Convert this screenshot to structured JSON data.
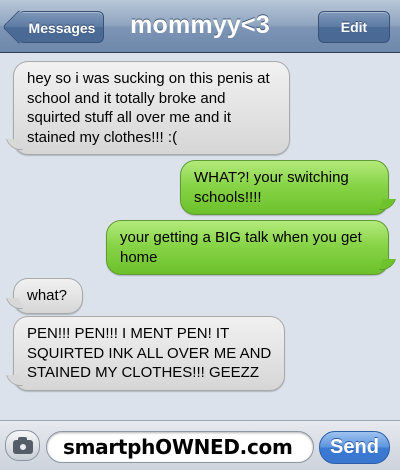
{
  "navbar": {
    "back_label": "Messages",
    "title": "mommyy<3",
    "edit_label": "Edit"
  },
  "messages": [
    {
      "direction": "incoming",
      "text": "hey so i was sucking on this penis at school and it totally broke and squirted stuff all over me and it stained my clothes!!! :("
    },
    {
      "direction": "outgoing",
      "text": "WHAT?! your switching schools!!!!"
    },
    {
      "direction": "outgoing",
      "text": "your getting a BIG talk when you get home"
    },
    {
      "direction": "incoming",
      "text": "what?"
    },
    {
      "direction": "incoming",
      "text": "PEN!!! PEN!!! I MENT PEN! IT SQUIRTED INK ALL OVER ME AND STAINED MY CLOTHES!!! GEEZZ"
    }
  ],
  "input": {
    "field_text": "smartphOWNED.com",
    "send_label": "Send"
  },
  "colors": {
    "nav_blue": "#6e88ab",
    "incoming_bubble": "#e4e4e4",
    "outgoing_bubble": "#88d448",
    "send_blue": "#3c7ad3",
    "background": "#dbe2ec"
  },
  "icons": {
    "camera": "camera-icon",
    "back": "back-chevron-icon"
  }
}
